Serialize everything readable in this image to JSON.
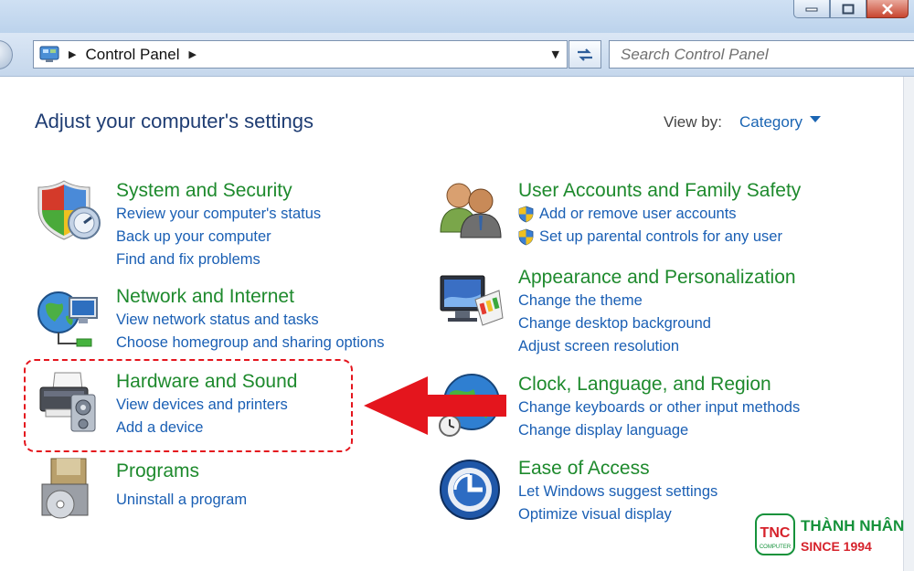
{
  "address_bar": {
    "path": "Control Panel"
  },
  "search": {
    "placeholder": "Search Control Panel"
  },
  "page": {
    "heading": "Adjust your computer's settings",
    "view_by_label": "View by:",
    "view_by_value": "Category"
  },
  "categories_left": [
    {
      "title": "System and Security",
      "icon": "shield-icon",
      "links": [
        "Review your computer's status",
        "Back up your computer",
        "Find and fix problems"
      ]
    },
    {
      "title": "Network and Internet",
      "icon": "network-globe-icon",
      "links": [
        "View network status and tasks",
        "Choose homegroup and sharing options"
      ]
    },
    {
      "title": "Hardware and Sound",
      "icon": "printer-icon",
      "links": [
        "View devices and printers",
        "Add a device"
      ]
    },
    {
      "title": "Programs",
      "icon": "programs-disc-icon",
      "links": [
        "Uninstall a program"
      ]
    }
  ],
  "categories_right": [
    {
      "title": "User Accounts and Family Safety",
      "icon": "users-icon",
      "links": [
        "Add or remove user accounts",
        "Set up parental controls for any user"
      ]
    },
    {
      "title": "Appearance and Personalization",
      "icon": "monitor-palette-icon",
      "links": [
        "Change the theme",
        "Change desktop background",
        "Adjust screen resolution"
      ]
    },
    {
      "title": "Clock, Language, and Region",
      "icon": "clock-globe-icon",
      "links": [
        "Change keyboards or other input methods",
        "Change display language"
      ]
    },
    {
      "title": "Ease of Access",
      "icon": "ease-of-access-icon",
      "links": [
        "Let Windows suggest settings",
        "Optimize visual display"
      ]
    }
  ],
  "watermark": {
    "badge_text": "TNC",
    "badge_sub": "COMPUTER",
    "name": "THÀNH NHÂN",
    "since": "SINCE 1994"
  },
  "colors": {
    "category_title": "#1e8a2d",
    "link": "#1a5fb4",
    "heading": "#1f3d73",
    "highlight_red": "#e4151d"
  }
}
